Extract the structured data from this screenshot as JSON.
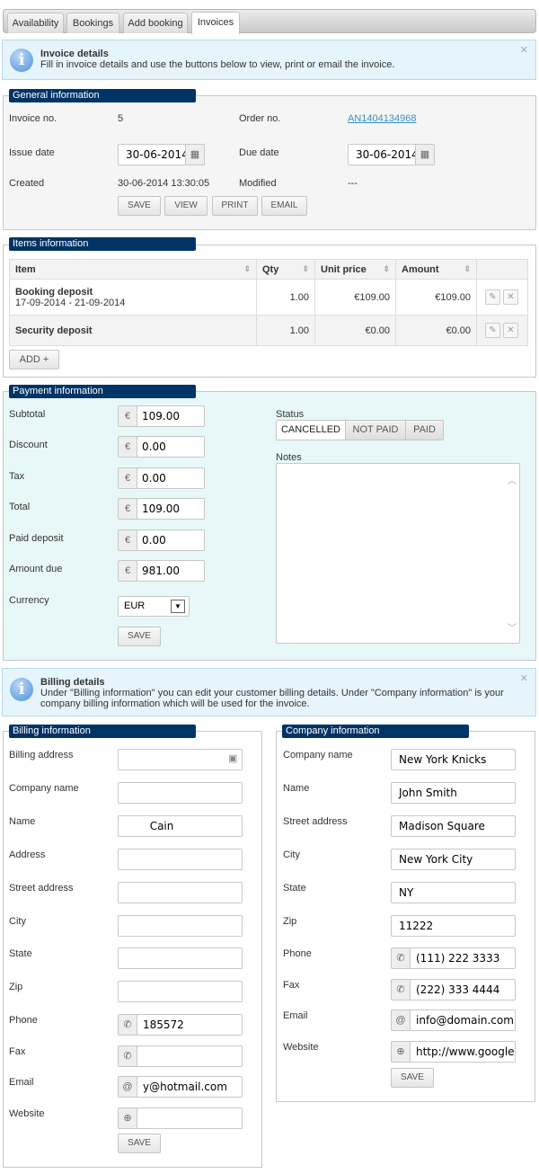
{
  "tabs": [
    "Availability",
    "Bookings",
    "Add booking",
    "Invoices"
  ],
  "invoice_info": {
    "title": "Invoice details",
    "text": "Fill in invoice details and use the buttons below to view, print or email the invoice."
  },
  "general": {
    "legend": "General information",
    "invoice_no_label": "Invoice no.",
    "invoice_no": "5",
    "order_no_label": "Order no.",
    "order_no": "AN1404134968",
    "issue_date_label": "Issue date",
    "issue_date": "30-06-2014",
    "due_date_label": "Due date",
    "due_date": "30-06-2014",
    "created_label": "Created",
    "created": "30-06-2014 13:30:05",
    "modified_label": "Modified",
    "modified": "---",
    "buttons": [
      "SAVE",
      "VIEW",
      "PRINT",
      "EMAIL"
    ]
  },
  "items": {
    "legend": "Items information",
    "columns": [
      "Item",
      "Qty",
      "Unit price",
      "Amount"
    ],
    "rows": [
      {
        "item": "Booking deposit",
        "sub": "17-09-2014 - 21-09-2014",
        "qty": "1.00",
        "unit": "€109.00",
        "amount": "€109.00"
      },
      {
        "item": "Security deposit",
        "sub": "",
        "qty": "1.00",
        "unit": "€0.00",
        "amount": "€0.00"
      }
    ],
    "add_label": "ADD +"
  },
  "payment": {
    "legend": "Payment information",
    "fields": [
      {
        "label": "Subtotal",
        "value": "109.00"
      },
      {
        "label": "Discount",
        "value": "0.00"
      },
      {
        "label": "Tax",
        "value": "0.00"
      },
      {
        "label": "Total",
        "value": "109.00"
      },
      {
        "label": "Paid deposit",
        "value": "0.00"
      },
      {
        "label": "Amount due",
        "value": "981.00"
      }
    ],
    "currency_symbol": "€",
    "currency_label": "Currency",
    "currency": "EUR",
    "save": "SAVE",
    "status_label": "Status",
    "statuses": [
      "CANCELLED",
      "NOT PAID",
      "PAID"
    ],
    "status_selected": "CANCELLED",
    "notes_label": "Notes",
    "notes": ""
  },
  "billing_info": {
    "title": "Billing details",
    "text": "Under \"Billing information\" you can edit your customer billing details. Under \"Company information\" is your company billing information which will be used for the invoice."
  },
  "billing": {
    "legend": "Billing information",
    "fields": [
      {
        "label": "Billing address",
        "value": "",
        "icon": "address-book-icon"
      },
      {
        "label": "Company name",
        "value": ""
      },
      {
        "label": "Name",
        "value": "       Cain"
      },
      {
        "label": "Address",
        "value": ""
      },
      {
        "label": "Street address",
        "value": ""
      },
      {
        "label": "City",
        "value": ""
      },
      {
        "label": "State",
        "value": ""
      },
      {
        "label": "Zip",
        "value": ""
      },
      {
        "label": "Phone",
        "value": "        185572",
        "addon": "phone-icon"
      },
      {
        "label": "Fax",
        "value": "",
        "addon": "phone-icon"
      },
      {
        "label": "Email",
        "value": "y@hotmail.com",
        "addon": "at-icon"
      },
      {
        "label": "Website",
        "value": "",
        "addon": "globe-icon"
      }
    ],
    "save": "SAVE"
  },
  "company": {
    "legend": "Company information",
    "fields": [
      {
        "label": "Company name",
        "value": "New York Knicks"
      },
      {
        "label": "Name",
        "value": "John Smith"
      },
      {
        "label": "Street address",
        "value": "Madison Square"
      },
      {
        "label": "City",
        "value": "New York City"
      },
      {
        "label": "State",
        "value": "NY"
      },
      {
        "label": "Zip",
        "value": "11222"
      },
      {
        "label": "Phone",
        "value": "(111) 222 3333",
        "addon": "phone-icon"
      },
      {
        "label": "Fax",
        "value": "(222) 333 4444",
        "addon": "phone-icon"
      },
      {
        "label": "Email",
        "value": "info@domain.com",
        "addon": "at-icon"
      },
      {
        "label": "Website",
        "value": "http://www.google.co",
        "addon": "globe-icon"
      }
    ],
    "save": "SAVE"
  },
  "colors": {
    "legend_bg": "#003366",
    "link": "#3a8fc8",
    "info_bg": "#e6f4fb",
    "payment_bg": "#e8f8f8"
  }
}
